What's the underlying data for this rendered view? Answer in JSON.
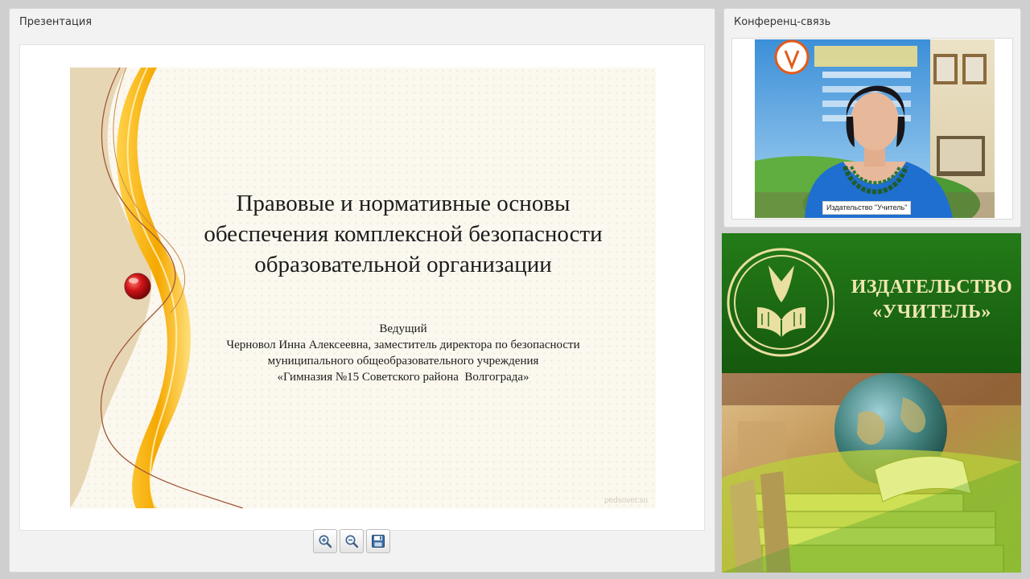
{
  "presentation": {
    "panel_title": "Презентация",
    "slide": {
      "title_lines": [
        "Правовые и нормативные основы",
        "обеспечения комплексной безопасности",
        "образовательной организации"
      ],
      "presenter_lines": [
        "Ведущий",
        "Черновол Инна Алексеевна, заместитель директора по безопасности",
        "муниципального общеобразовательного учреждения",
        "«Гимназия №15 Советского района  Волгограда»"
      ],
      "watermark": "pedsovet.su"
    },
    "toolbar": [
      {
        "name": "zoom-in",
        "icon": "zoom-in-icon"
      },
      {
        "name": "zoom-out",
        "icon": "zoom-out-icon"
      },
      {
        "name": "save",
        "icon": "floppy-disk-icon"
      }
    ]
  },
  "conference": {
    "panel_title": "Конференц-связь",
    "participant_label": "Издательство \"Учитель\""
  },
  "banner": {
    "name_lines": [
      "ИЗДАТЕЛЬСТВО",
      "«УЧИТЕЛЬ»"
    ]
  },
  "colors": {
    "brand_green": "#1f6f15",
    "brand_text": "#efe7b0",
    "slide_background": "#fbf8ef",
    "slide_accent": "#f7b500",
    "panel_background": "#f2f2f2"
  }
}
